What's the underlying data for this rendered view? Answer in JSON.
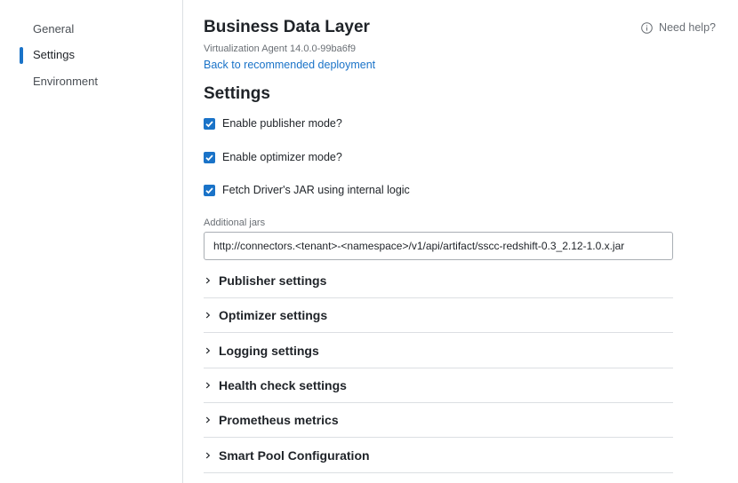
{
  "sidebar": {
    "items": [
      {
        "label": "General",
        "active": false
      },
      {
        "label": "Settings",
        "active": true
      },
      {
        "label": "Environment",
        "active": false
      }
    ]
  },
  "header": {
    "title": "Business Data Layer",
    "agent_version": "Virtualization Agent 14.0.0-99ba6f9",
    "back_link": "Back to recommended deployment",
    "help_label": "Need help?"
  },
  "settings": {
    "section_title": "Settings",
    "checkboxes": [
      {
        "label": "Enable publisher mode?",
        "checked": true
      },
      {
        "label": "Enable optimizer mode?",
        "checked": true
      },
      {
        "label": "Fetch Driver's JAR using internal logic",
        "checked": true
      }
    ],
    "additional_jars": {
      "label": "Additional jars",
      "value": "http://connectors.<tenant>-<namespace>/v1/api/artifact/sscc-redshift-0.3_2.12-1.0.x.jar"
    },
    "accordions": [
      {
        "label": "Publisher settings"
      },
      {
        "label": "Optimizer settings"
      },
      {
        "label": "Logging settings"
      },
      {
        "label": "Health check settings"
      },
      {
        "label": "Prometheus metrics"
      },
      {
        "label": "Smart Pool Configuration"
      }
    ]
  },
  "colors": {
    "accent": "#1a73c8",
    "divider": "#dcdfe3",
    "muted_text": "#6a6f75"
  }
}
